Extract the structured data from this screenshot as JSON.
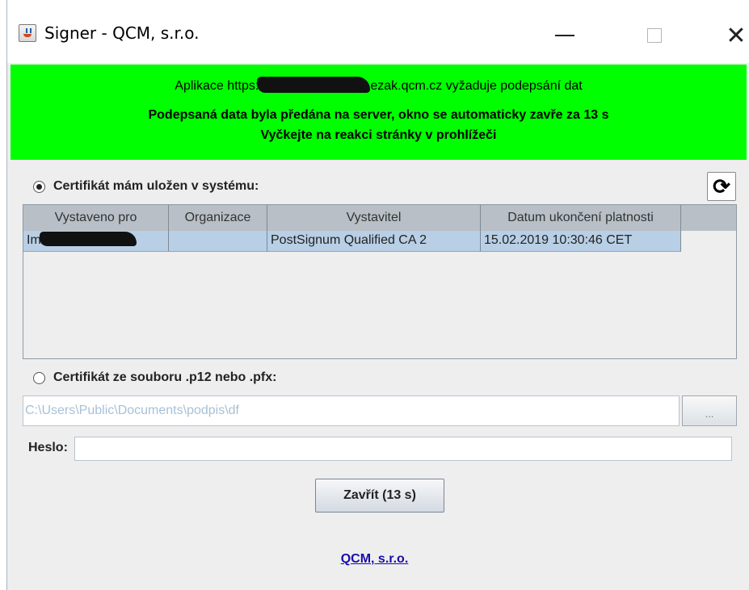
{
  "window": {
    "title": "Signer - QCM, s.r.o.",
    "controls": {
      "minimize": "—",
      "maximize": "☐",
      "close": "✕"
    }
  },
  "banner": {
    "line1_prefix": "Aplikace https:",
    "line1_suffix": "ezak.qcm.cz vyžaduje podepsání dat",
    "line2": "Podepsaná data byla předána na server, okno se automaticky zavře za 13 s",
    "line3": "Vyčkejte na reakci stránky v prohlížeči",
    "color": "#00ff00"
  },
  "system_cert": {
    "label": "Certifikát mám uložen v systému:",
    "selected": true,
    "table": {
      "columns": [
        "Vystaveno pro",
        "Organizace",
        "Vystavitel",
        "Datum ukončení platnosti"
      ],
      "rows": [
        {
          "issued_to": "Im",
          "organization": "",
          "issuer": "PostSignum Qualified CA 2",
          "expires": "15.02.2019 10:30:46 CET"
        }
      ]
    }
  },
  "file_cert": {
    "label": "Certifikát ze souboru .p12 nebo .pfx:",
    "selected": false,
    "path": "C:\\Users\\Public\\Documents\\podpis\\df",
    "browse_label": "..."
  },
  "password": {
    "label": "Heslo:",
    "value": ""
  },
  "close_button": "Zavřít (13 s)",
  "footer_link": "QCM, s.r.o.",
  "icons": {
    "refresh": "refresh-icon",
    "app": "java-cup-icon"
  }
}
